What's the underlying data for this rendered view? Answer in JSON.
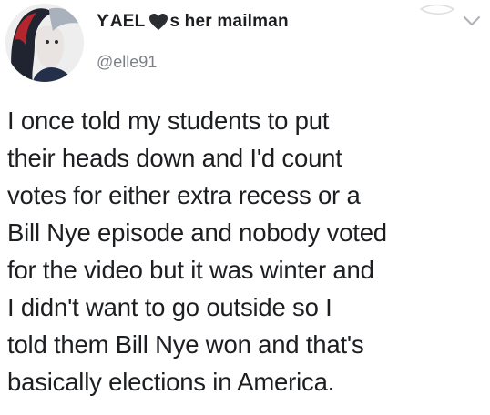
{
  "tweet": {
    "display_name_part1": "ƳAEL",
    "display_name_part2": "s her mailman",
    "handle": "@elle91",
    "body_lines": [
      "I once told my students to put",
      "their heads down and I'd count",
      "votes for either extra recess or a",
      "Bill Nye episode and nobody voted",
      "for the video but it was winter and",
      "I didn't want to go outside so I",
      "told them Bill Nye won and that's",
      "basically elections in America."
    ]
  },
  "icons": {
    "heart": "heart-icon",
    "chevron": "chevron-down-icon",
    "avatar": "avatar"
  },
  "colors": {
    "text": "#1c1e21",
    "handle": "#7b7f85",
    "heart": "#2a2d31"
  }
}
